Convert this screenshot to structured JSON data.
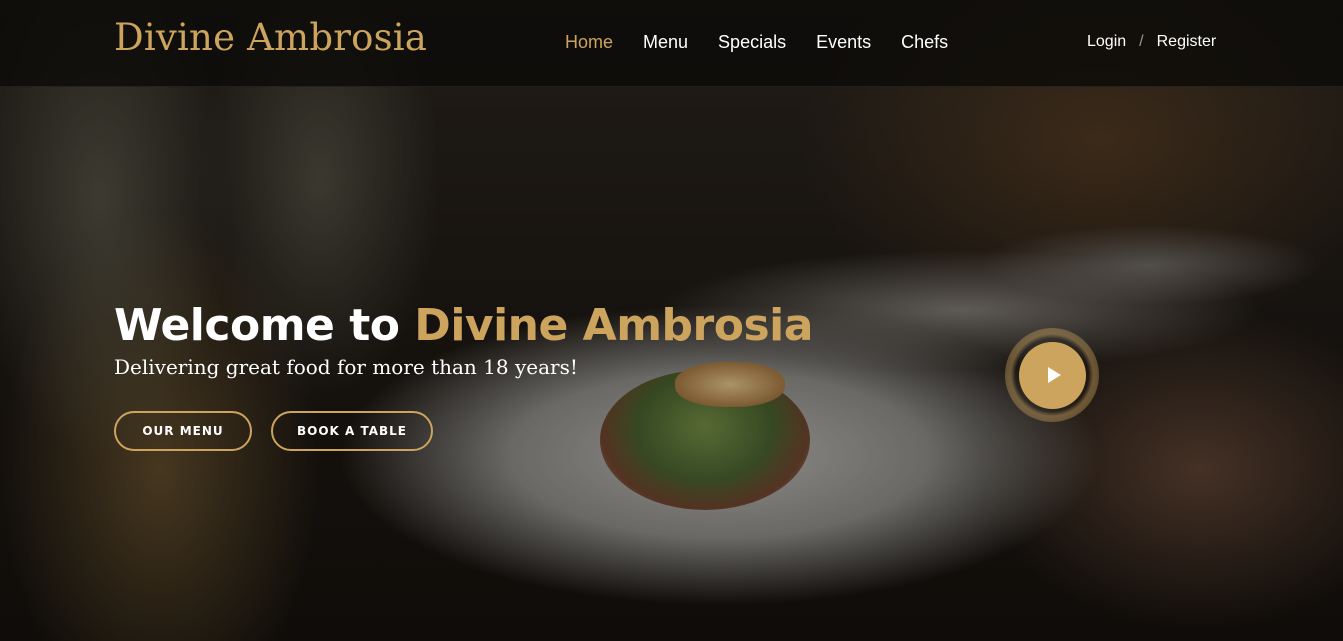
{
  "brand": {
    "name": "Divine Ambrosia",
    "accent_color": "#cda45e"
  },
  "nav": {
    "items": [
      {
        "label": "Home",
        "active": true
      },
      {
        "label": "Menu",
        "active": false
      },
      {
        "label": "Specials",
        "active": false
      },
      {
        "label": "Events",
        "active": false
      },
      {
        "label": "Chefs",
        "active": false
      }
    ]
  },
  "auth": {
    "login_label": "Login",
    "separator": "/",
    "register_label": "Register"
  },
  "hero": {
    "title_prefix": "Welcome to",
    "title_brand": "Divine Ambrosia",
    "subtitle": "Delivering great food for more than 18 years!",
    "buttons": {
      "menu_label": "OUR MENU",
      "book_label": "BOOK A TABLE"
    },
    "video_icon": "play-icon"
  }
}
